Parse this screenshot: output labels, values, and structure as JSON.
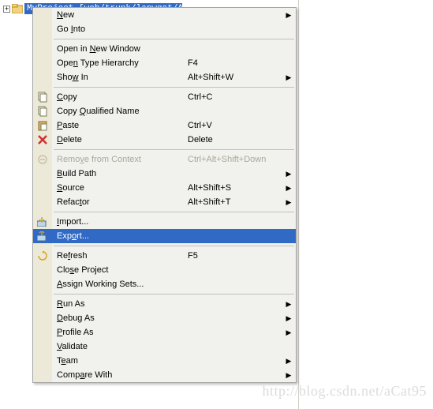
{
  "tree": {
    "project_label": "MyProject [web/trunk/lapwqat/AddaTu..."
  },
  "menu": {
    "new": {
      "label": "New",
      "mn": "N",
      "arrow": true
    },
    "go_into": {
      "label": "Go Into",
      "mn": "I"
    },
    "open_new_window": {
      "label": "Open in New Window",
      "mn": "N"
    },
    "open_type_hierarchy": {
      "label": "Open Type Hierarchy",
      "mn": "n",
      "shortcut": "F4"
    },
    "show_in": {
      "label": "Show In",
      "mn": "w",
      "shortcut": "Alt+Shift+W",
      "arrow": true
    },
    "copy": {
      "label": "Copy",
      "mn": "C",
      "shortcut": "Ctrl+C"
    },
    "copy_qn": {
      "label": "Copy Qualified Name",
      "mn": "Q"
    },
    "paste": {
      "label": "Paste",
      "mn": "P",
      "shortcut": "Ctrl+V"
    },
    "delete": {
      "label": "Delete",
      "mn": "D",
      "shortcut": "Delete"
    },
    "remove_ctx": {
      "label": "Remove from Context",
      "mn": "v",
      "shortcut": "Ctrl+Alt+Shift+Down",
      "disabled": true
    },
    "build_path": {
      "label": "Build Path",
      "mn": "B",
      "arrow": true
    },
    "source": {
      "label": "Source",
      "mn": "S",
      "shortcut": "Alt+Shift+S",
      "arrow": true
    },
    "refactor": {
      "label": "Refactor",
      "mn": "t",
      "shortcut": "Alt+Shift+T",
      "arrow": true
    },
    "import": {
      "label": "Import...",
      "mn": "I"
    },
    "export": {
      "label": "Export...",
      "mn": "o",
      "selected": true
    },
    "refresh": {
      "label": "Refresh",
      "mn": "f",
      "shortcut": "F5"
    },
    "close_project": {
      "label": "Close Project",
      "mn": "s"
    },
    "assign_ws": {
      "label": "Assign Working Sets...",
      "mn": "A"
    },
    "run_as": {
      "label": "Run As",
      "mn": "R",
      "arrow": true
    },
    "debug_as": {
      "label": "Debug As",
      "mn": "D",
      "arrow": true
    },
    "profile_as": {
      "label": "Profile As",
      "mn": "P",
      "arrow": true
    },
    "validate": {
      "label": "Validate",
      "mn": "V"
    },
    "team": {
      "label": "Team",
      "mn": "e",
      "arrow": true
    },
    "compare_with": {
      "label": "Compare With",
      "mn": "a",
      "arrow": true
    }
  },
  "watermark": "http://blog.csdn.net/aCat95"
}
